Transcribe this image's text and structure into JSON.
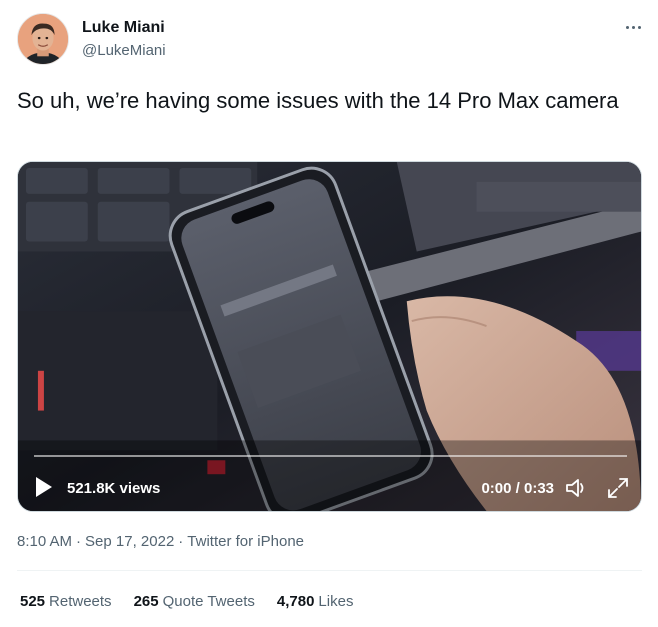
{
  "author": {
    "name": "Luke Miani",
    "handle": "@LukeMiani"
  },
  "tweet": {
    "text": "So uh, we’re having some issues with the 14 Pro Max camera"
  },
  "video": {
    "views": "521.8K views",
    "timecode": "0:00 / 0:33",
    "progress": 0
  },
  "meta": {
    "time": "8:10 AM",
    "separator": "·",
    "date": "Sep 17, 2022",
    "source": "Twitter for iPhone"
  },
  "stats": {
    "retweets_count": "525",
    "retweets_label": "Retweets",
    "quotes_count": "265",
    "quotes_label": "Quote Tweets",
    "likes_count": "4,780",
    "likes_label": "Likes"
  },
  "icons": {
    "more": "more-options-icon",
    "play": "play-icon",
    "volume": "volume-icon",
    "fullscreen": "fullscreen-icon"
  },
  "colors": {
    "text": "#0f1419",
    "secondary": "#536471",
    "divider": "#eff3f4"
  }
}
